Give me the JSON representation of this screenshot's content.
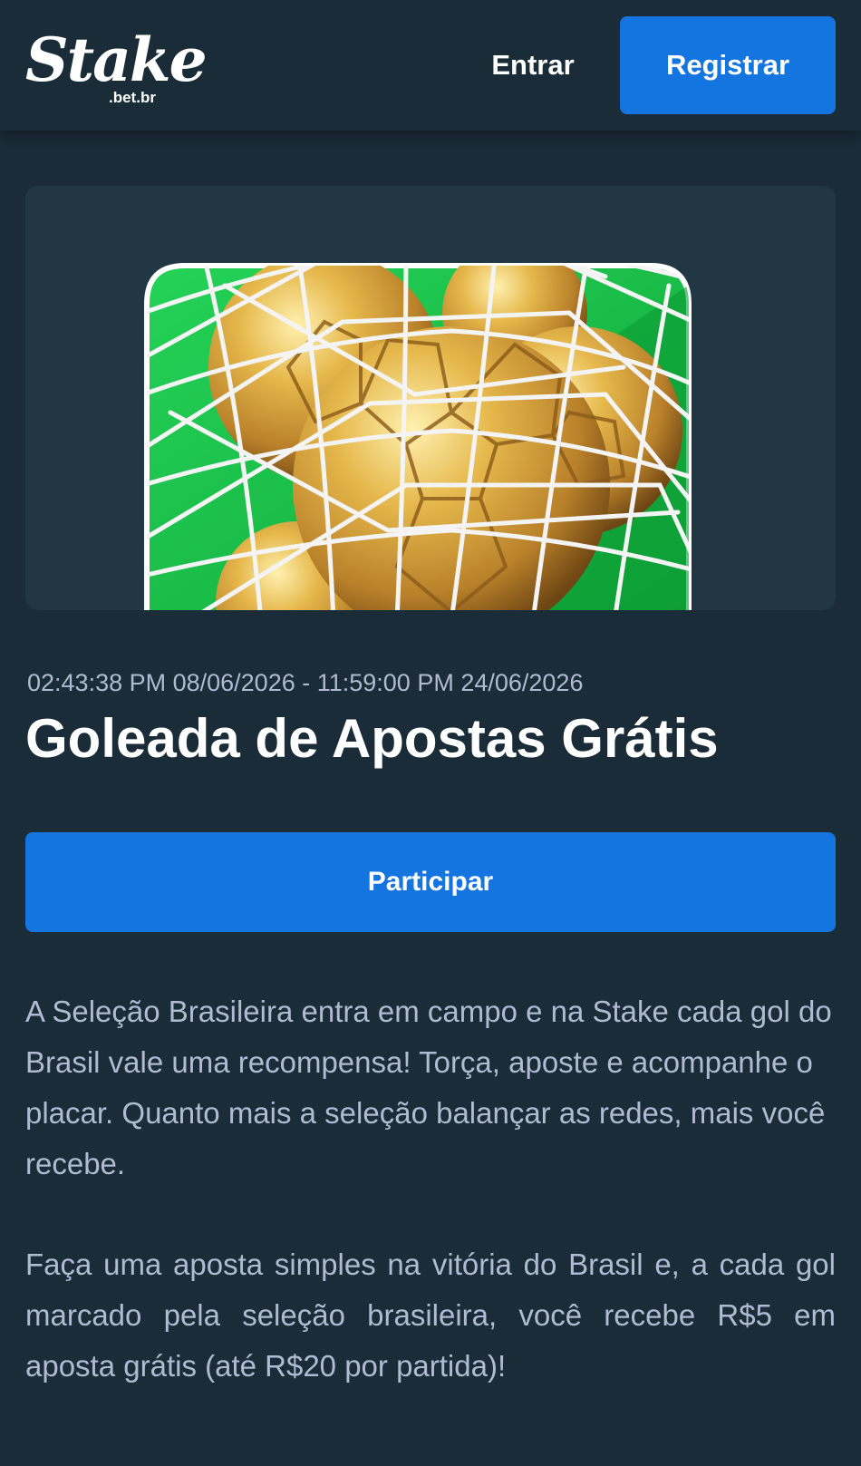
{
  "header": {
    "logo_text": "Stake",
    "logo_sub": ".bet.br",
    "login_label": "Entrar",
    "register_label": "Registrar"
  },
  "promo": {
    "date_range": "02:43:38 PM 08/06/2026 - 11:59:00 PM 24/06/2026",
    "title": "Goleada de Apostas Grátis",
    "cta_label": "Participar",
    "paragraph_1": "A Seleção Brasileira entra em campo e na Stake cada gol do Brasil vale uma recompensa! Torça, aposte e acompanhe o placar. Quanto mais a seleção balançar as redes, mais você recebe.",
    "paragraph_2": "Faça uma aposta simples na vitória do Brasil e, a cada gol marcado pela seleção brasileira, você recebe R$5 em aposta grátis (até R$20 por partida)!"
  },
  "colors": {
    "background": "#1a2c38",
    "card": "#213743",
    "accent_blue": "#1475e1",
    "muted_text": "#b1bad3",
    "hero_green": "#1fc34a",
    "gold": "#d9a43a"
  },
  "icons": {
    "hero_image": "golden-soccer-balls-in-net"
  }
}
